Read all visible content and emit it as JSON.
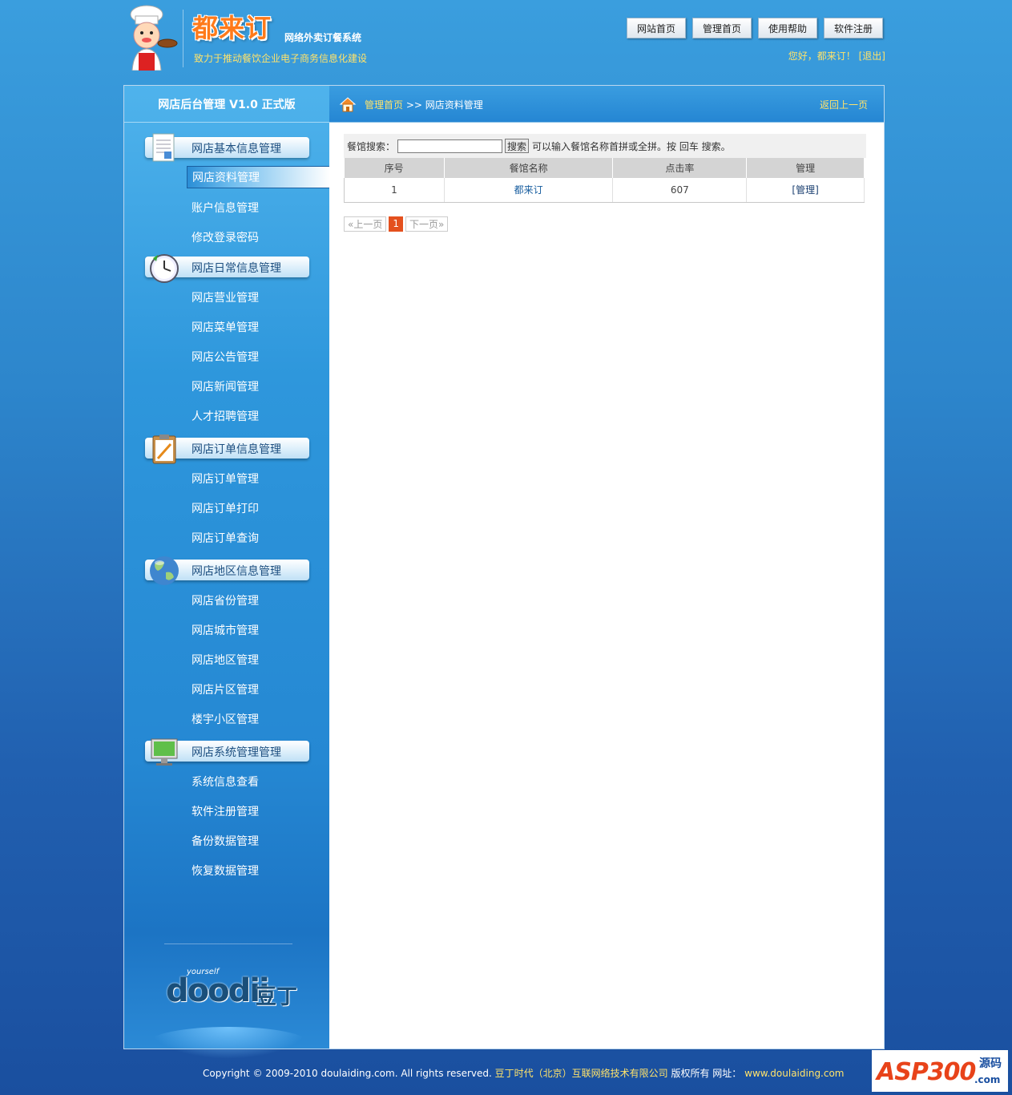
{
  "header": {
    "brand": "都来订",
    "subtitle": "网络外卖订餐系统",
    "slogan": "致力于推动餐饮企业电子商务信息化建设",
    "nav": [
      "网站首页",
      "管理首页",
      "使用帮助",
      "软件注册"
    ],
    "greeting": "您好，都来订！",
    "logout": "[退出]"
  },
  "sidebar": {
    "title": "网店后台管理  V1.0 正式版",
    "groups": [
      {
        "label": "网店基本信息管理",
        "icon": "document-icon",
        "items": [
          "网店资料管理",
          "账户信息管理",
          "修改登录密码"
        ]
      },
      {
        "label": "网店日常信息管理",
        "icon": "clock-icon",
        "items": [
          "网店营业管理",
          "网店菜单管理",
          "网店公告管理",
          "网店新闻管理",
          "人才招聘管理"
        ]
      },
      {
        "label": "网店订单信息管理",
        "icon": "clipboard-icon",
        "items": [
          "网店订单管理",
          "网店订单打印",
          "网店订单查询"
        ]
      },
      {
        "label": "网店地区信息管理",
        "icon": "globe-icon",
        "items": [
          "网店省份管理",
          "网店城市管理",
          "网店地区管理",
          "网店片区管理",
          "楼宇小区管理"
        ]
      },
      {
        "label": "网店系统管理管理",
        "icon": "monitor-icon",
        "items": [
          "系统信息查看",
          "软件注册管理",
          "备份数据管理",
          "恢复数据管理"
        ]
      }
    ],
    "bottom_logo": {
      "top": "yourself",
      "word": "doodii",
      "cn": "豆丁"
    }
  },
  "breadcrumb": {
    "home": "管理首页",
    "sep": ">>",
    "current": "网店资料管理",
    "back": "返回上一页"
  },
  "search": {
    "label": "餐馆搜索：",
    "value": "",
    "button": "搜索",
    "hint": "可以输入餐馆名称首拼或全拼。按 回车 搜索。"
  },
  "table": {
    "headers": [
      "序号",
      "餐馆名称",
      "点击率",
      "管理"
    ],
    "rows": [
      [
        "1",
        "都来订",
        "607",
        "[管理]"
      ]
    ]
  },
  "pager": {
    "prev": "«上一页",
    "current": "1",
    "next": "下一页»"
  },
  "footer": {
    "copyright": "Copyright © 2009-2010 doulaiding.com. All rights reserved.",
    "company": "豆丁时代（北京）互联网络技术有限公司",
    "rights": "版权所有  网址：",
    "url": "www.doulaiding.com"
  },
  "watermark": {
    "text": "ASP300",
    "sub": "源码",
    "domain": ".com"
  },
  "colors": {
    "accent": "#2586d3",
    "link_yellow": "#ffe36b",
    "pager_active": "#e4501e"
  }
}
